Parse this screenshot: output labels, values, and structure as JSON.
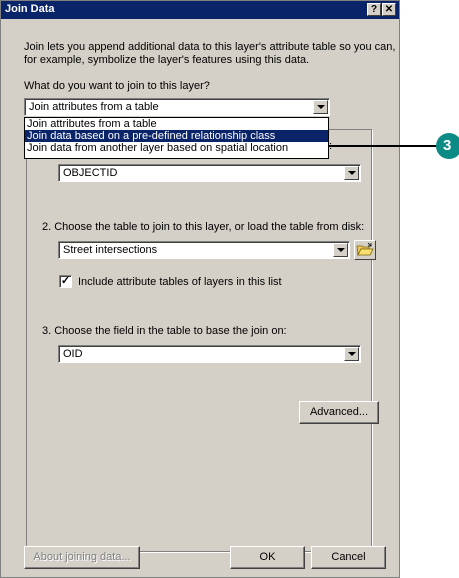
{
  "window": {
    "title": "Join Data",
    "help_button": "?",
    "close_button": "✕"
  },
  "intro": {
    "line1": "Join lets you append additional data to this layer's attribute table so you can,",
    "line2": "for example, symbolize the layer's features using this data."
  },
  "join_type": {
    "label": "What do you want to join to this layer?",
    "selected": "Join attributes from a table",
    "options": [
      "Join attributes from a table",
      "Join data based on a pre-defined relationship class",
      "Join data from another layer based on spatial location"
    ],
    "highlighted_index": 1
  },
  "step1": {
    "label_visible_fragment": ":",
    "field_value": "OBJECTID"
  },
  "step2": {
    "label": "2.  Choose the table to join to this layer, or load the table from disk:",
    "table_value": "Street intersections",
    "checkbox_checked": "✓",
    "checkbox_label": "Include attribute tables of layers in this list"
  },
  "step3": {
    "label": "3.  Choose the field in the table to base the join on:",
    "field_value": "OID"
  },
  "buttons": {
    "advanced": "Advanced...",
    "about": "About joining data...",
    "ok": "OK",
    "cancel": "Cancel"
  },
  "callout": {
    "number": "3",
    "color": "#0b8a86"
  }
}
